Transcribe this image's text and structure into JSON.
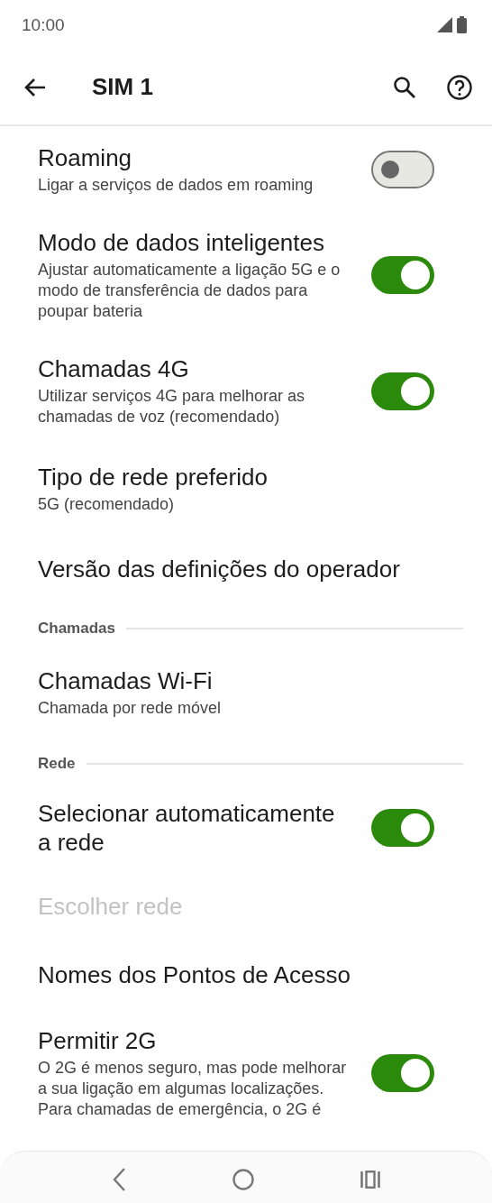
{
  "status_bar": {
    "time": "10:00"
  },
  "app_bar": {
    "title": "SIM 1"
  },
  "items": [
    {
      "kind": "toggle",
      "title": "Roaming",
      "summary": "Ligar a serviços de dados em roaming",
      "on": false,
      "disabled": false
    },
    {
      "kind": "toggle",
      "title": "Modo de dados inteligentes",
      "summary": "Ajustar automaticamente a ligação 5G e o modo de transferência de dados para poupar bateria",
      "on": true,
      "disabled": false
    },
    {
      "kind": "toggle",
      "title": "Chamadas 4G",
      "summary": "Utilizar serviços 4G para melhorar as chamadas de voz (recomendado)",
      "on": true,
      "disabled": false
    },
    {
      "kind": "text",
      "title": "Tipo de rede preferido",
      "summary": "5G (recomendado)",
      "disabled": false
    },
    {
      "kind": "text",
      "title": "Versão das definições do operador",
      "disabled": false
    },
    {
      "kind": "header",
      "title": "Chamadas"
    },
    {
      "kind": "text",
      "title": "Chamadas Wi-Fi",
      "summary": "Chamada por rede móvel",
      "disabled": false
    },
    {
      "kind": "header",
      "title": "Rede"
    },
    {
      "kind": "toggle",
      "title": "Selecionar automaticamente a rede",
      "on": true,
      "disabled": false
    },
    {
      "kind": "text",
      "title": "Escolher rede",
      "disabled": true
    },
    {
      "kind": "text",
      "title": "Nomes dos Pontos de Acesso",
      "disabled": false
    },
    {
      "kind": "toggle",
      "title": "Permitir 2G",
      "summary": "O 2G é menos seguro, mas pode melhorar a sua ligação em algumas localizações. Para chamadas de emergência, o 2G é",
      "on": true,
      "disabled": false
    }
  ]
}
